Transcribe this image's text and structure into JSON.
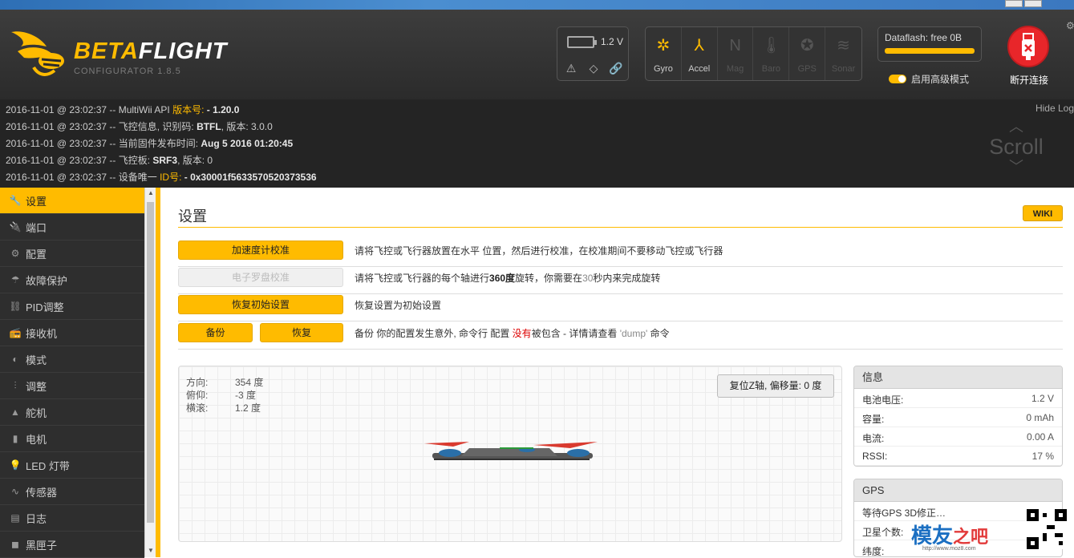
{
  "header": {
    "logo_main": "BETA",
    "logo_accent": "FLIGHT",
    "logo_sub": "CONFIGURATOR  1.8.5",
    "battery_voltage": "1.2 V",
    "sensors": [
      {
        "label": "Gyro",
        "glyph": "✲",
        "state": "on"
      },
      {
        "label": "Accel",
        "glyph": "⅄",
        "state": "on"
      },
      {
        "label": "Mag",
        "glyph": "N",
        "state": "off"
      },
      {
        "label": "Baro",
        "glyph": "🌡",
        "state": "off"
      },
      {
        "label": "GPS",
        "glyph": "✪",
        "state": "off"
      },
      {
        "label": "Sonar",
        "glyph": "≋",
        "state": "off"
      }
    ],
    "dataflash_label": "Dataflash: free 0B",
    "expert_mode_label": "启用高级模式",
    "disconnect_label": "断开连接",
    "accent_color": "#ffbb00"
  },
  "log": {
    "hide_label": "Hide Log",
    "scroll_label": "Scroll",
    "lines": [
      {
        "prefix": "2016-11-01 @ 23:02:37 -- MultiWii API ",
        "hl": "版本号: ",
        "bold": "- 1.20.0",
        "rest": ""
      },
      {
        "prefix": "2016-11-01 @ 23:02:37 -- 飞控信息, 识别码: ",
        "hl": "",
        "bold": "BTFL",
        "rest": ", 版本: 3.0.0"
      },
      {
        "prefix": "2016-11-01 @ 23:02:37 -- 当前固件发布时间: ",
        "hl": "",
        "bold": "Aug 5 2016 01:20:45",
        "rest": ""
      },
      {
        "prefix": "2016-11-01 @ 23:02:37 -- 飞控板: ",
        "hl": "",
        "bold": "SRF3",
        "rest": ", 版本: 0"
      },
      {
        "prefix": "2016-11-01 @ 23:02:37 -- 设备唯一 ",
        "hl": "ID号: ",
        "bold": "- 0x30001f5633570520373536",
        "rest": ""
      }
    ]
  },
  "sidebar": {
    "items": [
      {
        "label": "设置",
        "icon": "wrench-icon",
        "glyph": "🔧",
        "active": true
      },
      {
        "label": "端口",
        "icon": "plug-icon",
        "glyph": "🔌",
        "active": false
      },
      {
        "label": "配置",
        "icon": "gear-icon",
        "glyph": "⚙",
        "active": false
      },
      {
        "label": "故障保护",
        "icon": "parachute-icon",
        "glyph": "☂",
        "active": false
      },
      {
        "label": "PID调整",
        "icon": "pid-icon",
        "glyph": "⛓",
        "active": false
      },
      {
        "label": "接收机",
        "icon": "receiver-icon",
        "glyph": "📻",
        "active": false
      },
      {
        "label": "模式",
        "icon": "toggle-icon",
        "glyph": "◐",
        "active": false
      },
      {
        "label": "调整",
        "icon": "sliders-icon",
        "glyph": "⫶",
        "active": false
      },
      {
        "label": "舵机",
        "icon": "servo-icon",
        "glyph": "▲",
        "active": false
      },
      {
        "label": "电机",
        "icon": "motor-icon",
        "glyph": "▮",
        "active": false
      },
      {
        "label": "LED 灯带",
        "icon": "led-icon",
        "glyph": "💡",
        "active": false
      },
      {
        "label": "传感器",
        "icon": "pulse-icon",
        "glyph": "∿",
        "active": false
      },
      {
        "label": "日志",
        "icon": "log-icon",
        "glyph": "▤",
        "active": false
      },
      {
        "label": "黑匣子",
        "icon": "blackbox-icon",
        "glyph": "◼",
        "active": false
      }
    ]
  },
  "main": {
    "title": "设置",
    "wiki_label": "WIKI",
    "rows": [
      {
        "button": "加速度计校准",
        "desc": "请将飞控或飞行器放置在水平 位置，然后进行校准，在校准期间不要移动飞控或飞行器"
      },
      {
        "button": "电子罗盘校准",
        "desc_a": "请将飞控或飞行器的每个轴进行",
        "desc_b": "360度",
        "desc_c": "旋转，你需要在",
        "desc_d": "30",
        "desc_e": "秒内来完成旋转"
      },
      {
        "button": "恢复初始设置",
        "desc": "恢复设置为初始设置"
      },
      {
        "button_a": "备份",
        "button_b": "恢复",
        "desc_a": "备份 你的配置发生意外, 命令行 配置 ",
        "desc_b": "没有",
        "desc_c": "被包含 - 详情请查看 ",
        "desc_d": "'dump'",
        "desc_e": " 命令"
      }
    ],
    "attitude": {
      "heading_label": "方向:",
      "heading_value": "354 度",
      "pitch_label": "俯仰:",
      "pitch_value": "-3 度",
      "roll_label": "横滚:",
      "roll_value": "1.2 度"
    },
    "reset_z_label": "复位Z轴, 偏移量: 0 度"
  },
  "info_panel": {
    "title": "信息",
    "rows": [
      {
        "key": "电池电压:",
        "value": "1.2 V"
      },
      {
        "key": "容量:",
        "value": "0 mAh"
      },
      {
        "key": "电流:",
        "value": "0.00 A"
      },
      {
        "key": "RSSI:",
        "value": "17 %"
      }
    ]
  },
  "gps_panel": {
    "title": "GPS",
    "rows": [
      {
        "key": "等待GPS 3D修正…",
        "value": ""
      },
      {
        "key": "卫星个数:",
        "value": ""
      },
      {
        "key": "纬度:",
        "value": ""
      }
    ]
  },
  "watermark": {
    "text_a": "模友",
    "text_b": "之吧",
    "url": "http://www.moz8.com"
  }
}
